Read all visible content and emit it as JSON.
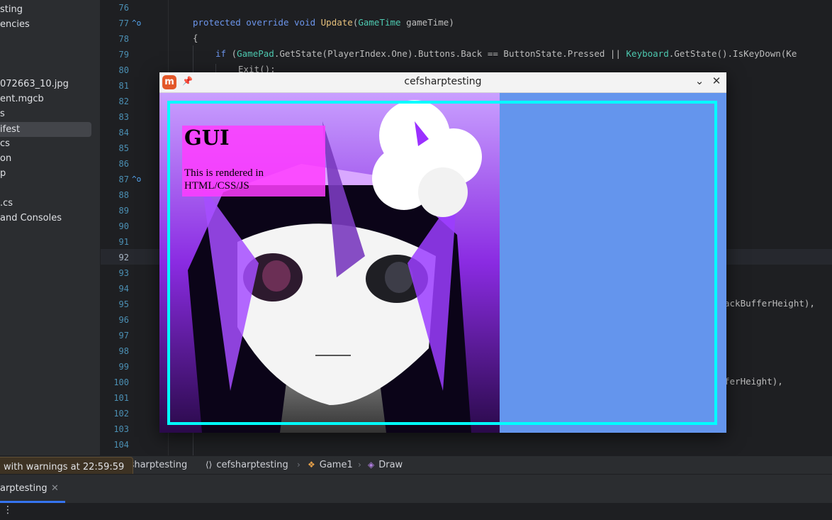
{
  "sidebar": {
    "items": [
      {
        "label": "sting"
      },
      {
        "label": "encies"
      },
      {
        "label": "072663_10.jpg"
      },
      {
        "label": "ent.mgcb"
      },
      {
        "label": "s"
      },
      {
        "label": "ifest"
      },
      {
        "label": "cs"
      },
      {
        "label": "on"
      },
      {
        "label": "p"
      },
      {
        "label": ".cs"
      },
      {
        "label": "and Consoles"
      }
    ]
  },
  "editor": {
    "line_numbers": [
      "76",
      "77",
      "78",
      "79",
      "80",
      "81",
      "82",
      "83",
      "84",
      "85",
      "86",
      "87",
      "88",
      "89",
      "90",
      "91",
      "92",
      "93",
      "94",
      "95",
      "96",
      "97",
      "98",
      "99",
      "100",
      "101",
      "102",
      "103",
      "104"
    ],
    "code": {
      "l77_kw1": "protected",
      "l77_kw2": "override",
      "l77_kw3": "void",
      "l77_fn": "Update",
      "l77_type": "GameTime",
      "l77_param": "gameTime",
      "l78": "{",
      "l79_if": "if",
      "l79_gp": "GamePad",
      "l79_rest1": ".GetState(PlayerIndex.One).Buttons.Back == ButtonState.Pressed || ",
      "l79_kb": "Keyboard",
      "l79_rest2": ".GetState().IsKeyDown(Ke",
      "l80": "Exit();",
      "l95_frag": "ackBufferHeight),",
      "l100_frag": "ferHeight),"
    }
  },
  "game_window": {
    "title": "cefsharptesting",
    "app_icon_letter": "m",
    "gui_title": "GUI",
    "gui_text": "This is rendered in HTML/CSS/JS",
    "colors": {
      "background": "#6495ed",
      "frame": "#00ffff",
      "panel": "#ff3cff"
    }
  },
  "toast": {
    "text": "with warnings at 22:59:59"
  },
  "breadcrumb": {
    "project": "efsharptesting",
    "namespace": "cefsharptesting",
    "class": "Game1",
    "method": "Draw"
  },
  "bottom": {
    "run_tab": "arptesting"
  },
  "icons": {
    "namespace": "braces-icon",
    "class": "class-icon",
    "method": "method-icon",
    "pin": "pin-icon",
    "more": "kebab-icon"
  }
}
